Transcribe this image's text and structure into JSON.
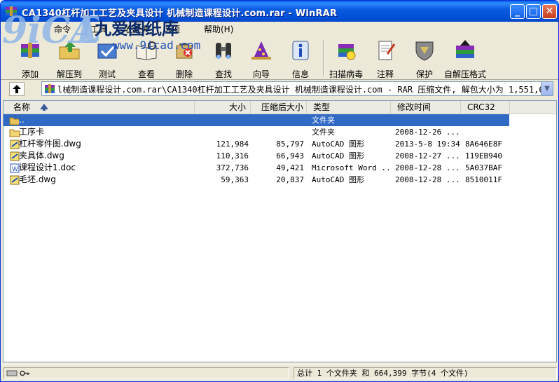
{
  "window": {
    "title": "CA1340杠杆加工工艺及夹具设计 机械制造课程设计.com.rar - WinRAR",
    "minimize": "_",
    "maximize": "□",
    "close": "✕"
  },
  "menu": [
    "命令",
    "工具",
    "收藏夹",
    "选项",
    "帮助(H)"
  ],
  "toolbar": {
    "add": "添加",
    "extract": "解压到",
    "test": "测试",
    "view": "查看",
    "delete": "删除",
    "find": "查找",
    "wizard": "向导",
    "info": "信息",
    "virusscan": "扫描病毒",
    "comment": "注释",
    "protect": "保护",
    "sfx": "自解压格式"
  },
  "address": {
    "path": "l械制造课程设计.com.rar\\CA1340杠杆加工工艺及夹具设计 机械制造课程设计.com - RAR 压缩文件, 解包大小为 1,551,695 字节"
  },
  "columns": {
    "name": "名称",
    "size": "大小",
    "packed": "压缩后大小",
    "type": "类型",
    "modified": "修改时间",
    "crc": "CRC32"
  },
  "rows": [
    {
      "name": "..",
      "size": "",
      "packed": "",
      "type": "文件夹",
      "modified": "",
      "crc": "",
      "icon": "folder-up-icon",
      "selected": true
    },
    {
      "name": "工序卡",
      "size": "",
      "packed": "",
      "type": "文件夹",
      "modified": "2008-12-26 ...",
      "crc": "",
      "icon": "folder-icon",
      "selected": false
    },
    {
      "name": "杠杆零件图.dwg",
      "size": "121,984",
      "packed": "85,797",
      "type": "AutoCAD 图形",
      "modified": "2013-5-8 19:34",
      "crc": "8A646E8F",
      "icon": "dwg-file-icon",
      "selected": false
    },
    {
      "name": "夹具体.dwg",
      "size": "110,316",
      "packed": "66,943",
      "type": "AutoCAD 图形",
      "modified": "2008-12-27 ...",
      "crc": "119EB940",
      "icon": "dwg-file-icon",
      "selected": false
    },
    {
      "name": "课程设计1.doc",
      "size": "372,736",
      "packed": "49,421",
      "type": "Microsoft Word ...",
      "modified": "2008-12-28 ...",
      "crc": "5A037BAF",
      "icon": "doc-file-icon",
      "selected": false
    },
    {
      "name": "毛坯.dwg",
      "size": "59,363",
      "packed": "20,837",
      "type": "AutoCAD 图形",
      "modified": "2008-12-28 ...",
      "crc": "8510011F",
      "icon": "dwg-file-icon",
      "selected": false
    }
  ],
  "status": {
    "summary": "总计 1 个文件夹 和 664,399 字节(4 个文件)"
  },
  "watermark": {
    "brand": "九爱图纸库",
    "url": "www.9icad.com"
  }
}
